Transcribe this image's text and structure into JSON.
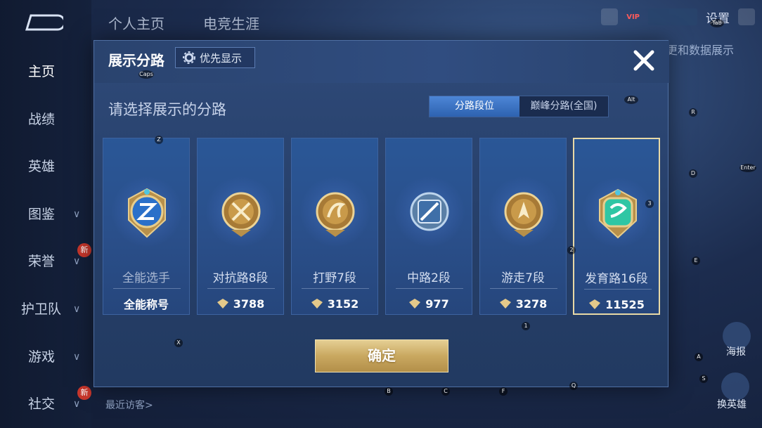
{
  "nav": {
    "items": [
      {
        "label": "主页"
      },
      {
        "label": "战绩"
      },
      {
        "label": "英雄"
      },
      {
        "label": "图鉴"
      },
      {
        "label": "荣誉"
      },
      {
        "label": "护卫队"
      },
      {
        "label": "游戏"
      },
      {
        "label": "社交"
      }
    ],
    "new_badge": "新"
  },
  "top": {
    "tabs": [
      "个人主页",
      "电竞生涯"
    ],
    "settings": "设置",
    "bg_text": "更和数据展示",
    "vip_label": "VIP"
  },
  "recent_visitors": "最近访客>",
  "dialog": {
    "title": "展示分路",
    "priority_label": "优先显示",
    "subtitle": "请选择展示的分路",
    "toggle": {
      "active": "分路段位",
      "inactive": "巅峰分路(全国)"
    },
    "confirm": "确定",
    "cards": [
      {
        "role": "全能选手",
        "foot": "全能称号",
        "has_score_icon": false,
        "emblem_color": "#3b7fd6",
        "emblem": "allround"
      },
      {
        "role": "对抗路8段",
        "foot": "3788",
        "has_score_icon": true,
        "emblem_color": "#c99a4a",
        "emblem": "clash-lane"
      },
      {
        "role": "打野7段",
        "foot": "3152",
        "has_score_icon": true,
        "emblem_color": "#c99a4a",
        "emblem": "jungle"
      },
      {
        "role": "中路2段",
        "foot": "977",
        "has_score_icon": true,
        "emblem_color": "#6fa5d8",
        "emblem": "mid-lane"
      },
      {
        "role": "游走7段",
        "foot": "3278",
        "has_score_icon": true,
        "emblem_color": "#c99a4a",
        "emblem": "roam"
      },
      {
        "role": "发育路16段",
        "foot": "11525",
        "has_score_icon": true,
        "emblem_color": "#3fd1b0",
        "emblem": "farm-lane"
      }
    ],
    "selected_index": 5
  },
  "key_hints": [
    "Z",
    "X",
    "B",
    "C",
    "F",
    "Q",
    "1",
    "2",
    "3",
    "R",
    "D",
    "E",
    "A",
    "S",
    "Alt",
    "Enter",
    "Tab",
    "Caps"
  ],
  "right_buttons": [
    {
      "label": "海报"
    },
    {
      "label": "换英雄"
    }
  ],
  "colors": {
    "gold": "#c9a860",
    "accent_blue": "#2d62b0",
    "selected_border": "#e8d9a6"
  }
}
